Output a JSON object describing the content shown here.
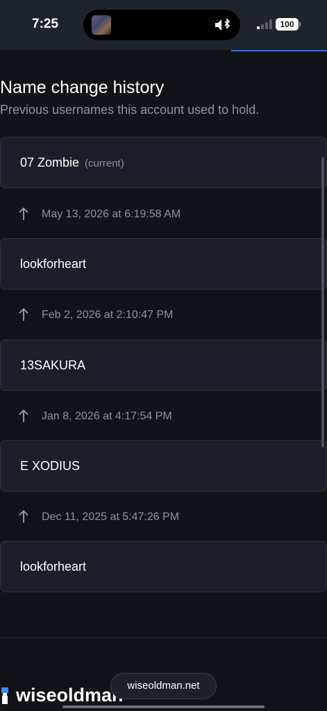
{
  "status_bar": {
    "time": "7:25",
    "battery": "100"
  },
  "section": {
    "title": "Name change history",
    "subtitle": "Previous usernames this account used to hold."
  },
  "names": [
    {
      "name": "07 Zombie",
      "tag": "(current)"
    },
    {
      "name": "lookforheart"
    },
    {
      "name": "13SAKURA"
    },
    {
      "name": "E XODIUS"
    },
    {
      "name": "lookforheart"
    }
  ],
  "changes": [
    {
      "date": "May 13, 2026 at 6:19:58 AM"
    },
    {
      "date": "Feb 2, 2026 at 2:10:47 PM"
    },
    {
      "date": "Jan 8, 2026 at 4:17:54 PM"
    },
    {
      "date": "Dec 11, 2025 at 5:47:26 PM"
    }
  ],
  "footer": {
    "brand": "wiseoldman",
    "url": "wiseoldman.net"
  },
  "icons": {
    "change": "arrow-up-icon",
    "sound": "speaker-icon",
    "bluetooth": "bluetooth-icon"
  },
  "colors": {
    "background": "#111318",
    "card": "#1c1f27",
    "muted_text": "#8b93a3",
    "accent": "#3d6fd8"
  }
}
